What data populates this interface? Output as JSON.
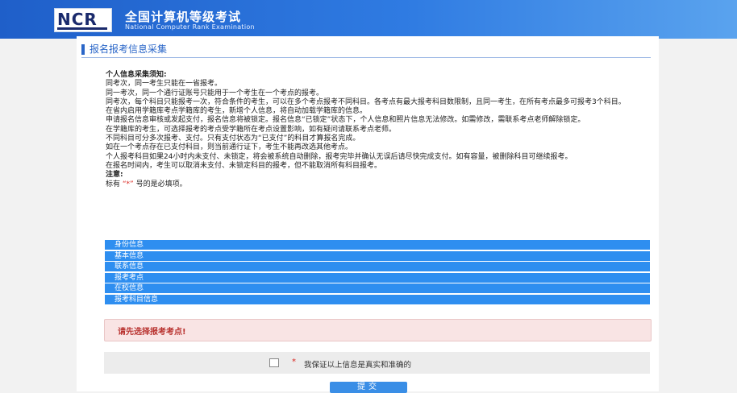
{
  "header": {
    "logo_text": "NCR",
    "title_cn": "全国计算机等级考试",
    "title_en": "National Computer Rank Examination"
  },
  "section": {
    "title": "报名报考信息采集"
  },
  "notice": {
    "heading": "个人信息采集须知:",
    "lines": [
      "同考次，同一考生只能在一省报考。",
      "同一考次，同一个通行证账号只能用于一个考生在一个考点的报考。",
      "同考次，每个科目只能报考一次，符合条件的考生，可以在多个考点报考不同科目。各考点有最大报考科目数限制，且同一考生，在所有考点最多可报考3个科目。",
      "在省内启用学籍库考点学籍库的考生，新增个人信息，将自动加载学籍库的信息。",
      "申请报名信息审核或发起支付，报名信息将被锁定。报名信息“已锁定”状态下，个人信息和照片信息无法修改。如需修改，需联系考点老师解除锁定。",
      "在学籍库的考生，可选择报考的考点受学籍所在考点设置影响，如有疑问请联系考点老师。",
      "不同科目可分多次报考、支付。只有支付状态为“已支付”的科目才算报名完成。",
      "如在一个考点存在已支付科目，则当前通行证下，考生不能再改选其他考点。",
      "个人报考科目如果24小时内未支付、未锁定，将会被系统自动删除，报考完毕并确认无误后请尽快完成支付。如有容量，被删除科目可继续报考。",
      "在报名时间内，考生可以取消未支付、未锁定科目的报考，但不能取消所有科目报考。"
    ],
    "note_label": "注意:",
    "note_prefix": "标有",
    "note_star": "“*”",
    "note_suffix": "号的是必填项。"
  },
  "bars": [
    "身份信息",
    "基本信息",
    "联系信息",
    "报考考点",
    "在校信息",
    "报考科目信息"
  ],
  "alert": {
    "text": "请先选择报考考点!"
  },
  "confirm": {
    "star": "*",
    "label": "我保证以上信息是真实和准确的"
  },
  "submit": {
    "label": "提交"
  },
  "colors": {
    "header": "#2f7be2",
    "bar": "#2e8ef0",
    "alert_bg": "#f9e4e4",
    "alert_text": "#b8322f"
  }
}
